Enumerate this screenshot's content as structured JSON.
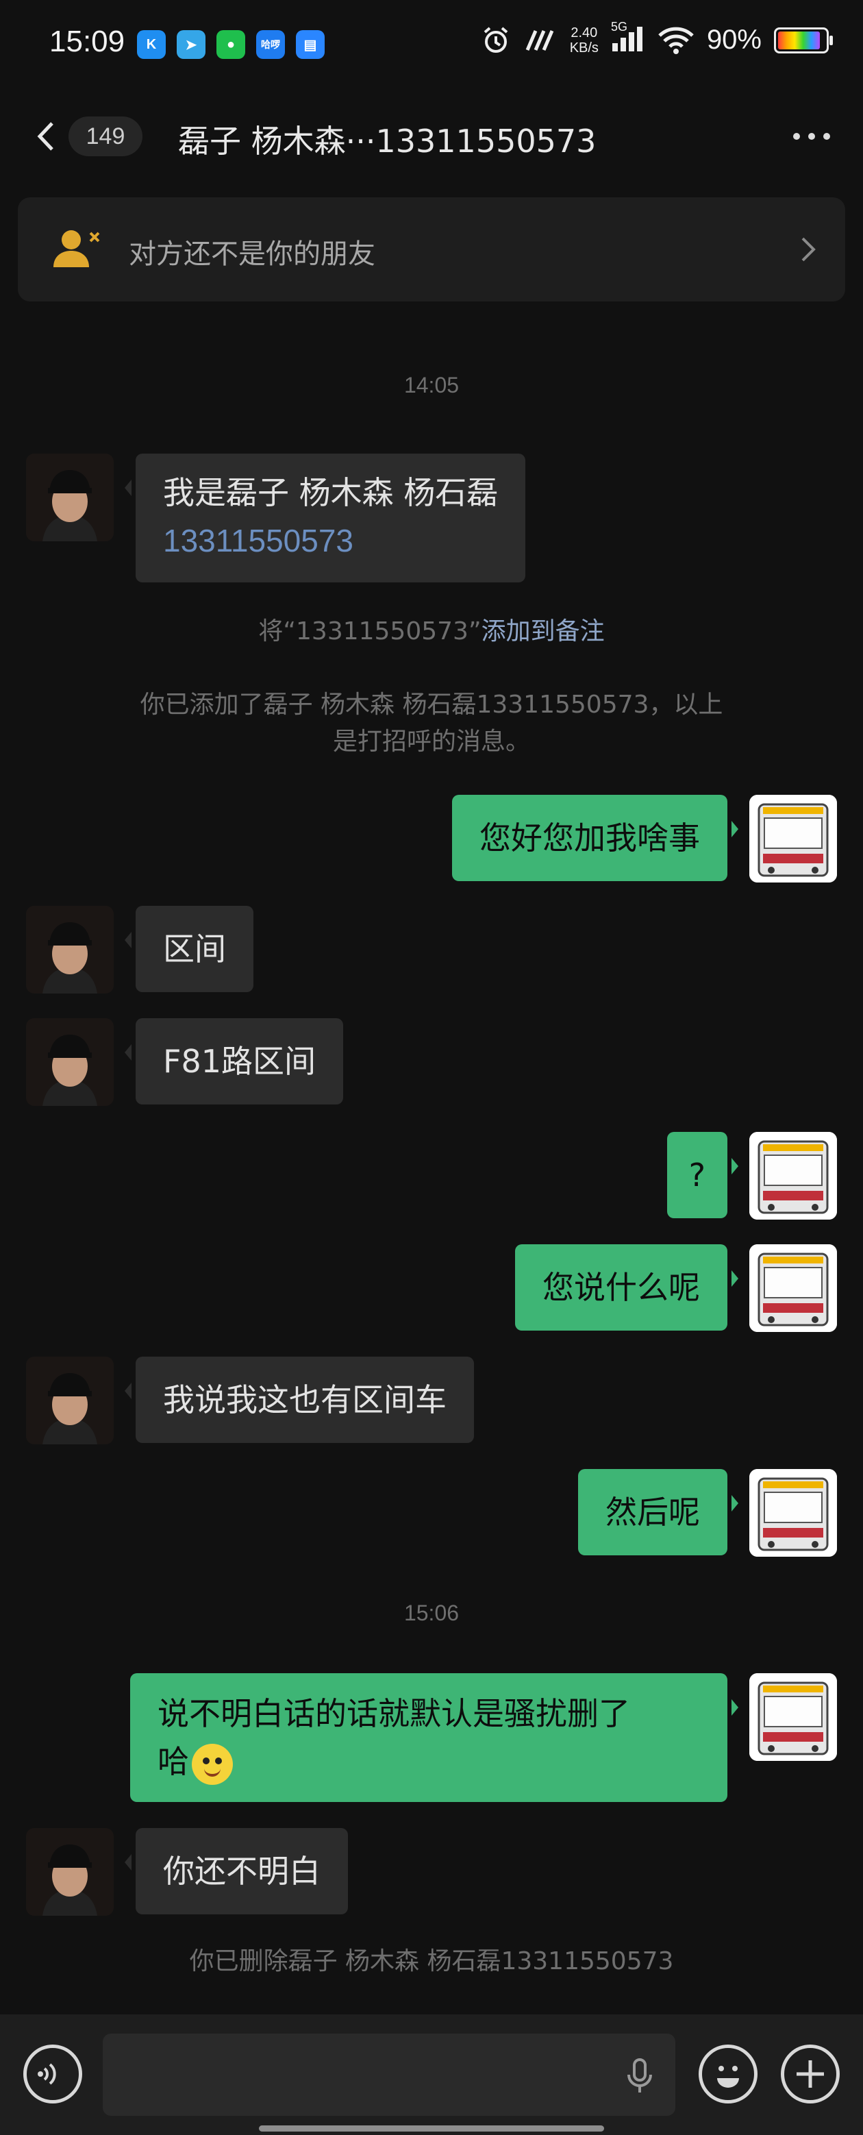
{
  "status_bar": {
    "time": "15:09",
    "net_speed": "2.40",
    "net_unit": "KB/s",
    "signal": "5G",
    "battery": "90%",
    "app_icons": [
      {
        "label": "K",
        "color": "#1f8ef1"
      },
      {
        "label": "➤",
        "color": "#35a6e8"
      },
      {
        "label": "●",
        "color": "#1fbf4d"
      },
      {
        "label": "哈啰",
        "color": "#1f7cf0"
      },
      {
        "label": "▤",
        "color": "#2a86ff"
      }
    ]
  },
  "header": {
    "unread_count": "149",
    "title": "磊子   杨木森···13311550573"
  },
  "banner": {
    "text": "对方还不是你的朋友"
  },
  "chat": {
    "time_1": "14:05",
    "msg_1_line1": "我是磊子   杨木森  杨石磊",
    "msg_1_line2": "13311550573",
    "notice_prefix": "将“13311550573”",
    "notice_link": "添加到备注",
    "notice_added_line1": "你已添加了磊子   杨木森  杨石磊13311550573，以上",
    "notice_added_line2": "是打招呼的消息。",
    "msg_2": "您好您加我啥事",
    "msg_3": "区间",
    "msg_4": "F81路区间",
    "msg_5": "?",
    "msg_6": "您说什么呢",
    "msg_7": "我说我这也有区间车",
    "msg_8": "然后呢",
    "time_2": "15:06",
    "msg_9_line1": "说不明白话的话就默认是骚扰删了",
    "msg_9_line2": "哈",
    "msg_10": "你还不明白",
    "notice_deleted": "你已删除磊子   杨木森  杨石磊13311550573"
  },
  "colors": {
    "background": "#111111",
    "bubble_out": "#3eb575",
    "bubble_in": "#2c2c2c",
    "link": "#8fa6c9",
    "banner_icon": "#e0a82e"
  }
}
